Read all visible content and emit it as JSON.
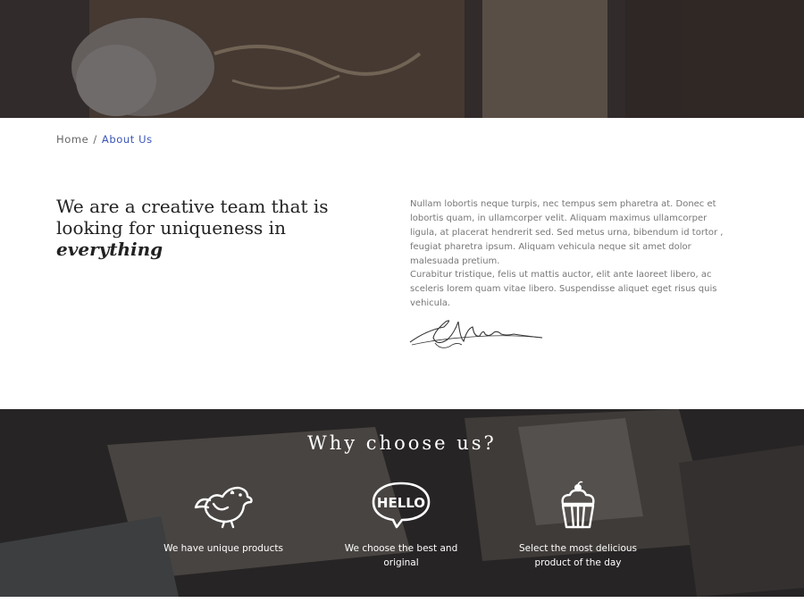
{
  "breadcrumb": {
    "home": "Home",
    "separator": "/",
    "current": "About Us"
  },
  "about": {
    "headline_prefix": "We are a creative team that is looking for uniqueness in",
    "headline_emphasis": "everything",
    "paragraph_1": "Nullam lobortis neque turpis, nec tempus sem pharetra at. Donec et lobortis quam, in ullamcorper velit. Aliquam maximus ullamcorper ligula, at placerat hendrerit sed. Sed metus urna, bibendum id tortor , feugiat pharetra ipsum. Aliquam vehicula neque sit amet dolor malesuada pretium.",
    "paragraph_2": "Curabitur tristique, felis ut mattis auctor, elit ante laoreet libero, ac sceleris lorem quam vitae libero. Suspendisse aliquet eget risus quis vehicula."
  },
  "why": {
    "title": "Why choose us?",
    "features": [
      {
        "icon": "bird-icon",
        "label": "We have unique products"
      },
      {
        "icon": "hello-speech-bubble-icon",
        "label": "We choose the best and original"
      },
      {
        "icon": "cupcake-icon",
        "label": "Select the most delicious product of the day"
      }
    ]
  },
  "colors": {
    "accent": "#3a55b8",
    "text_dark": "#222222",
    "text_muted": "#777777"
  }
}
